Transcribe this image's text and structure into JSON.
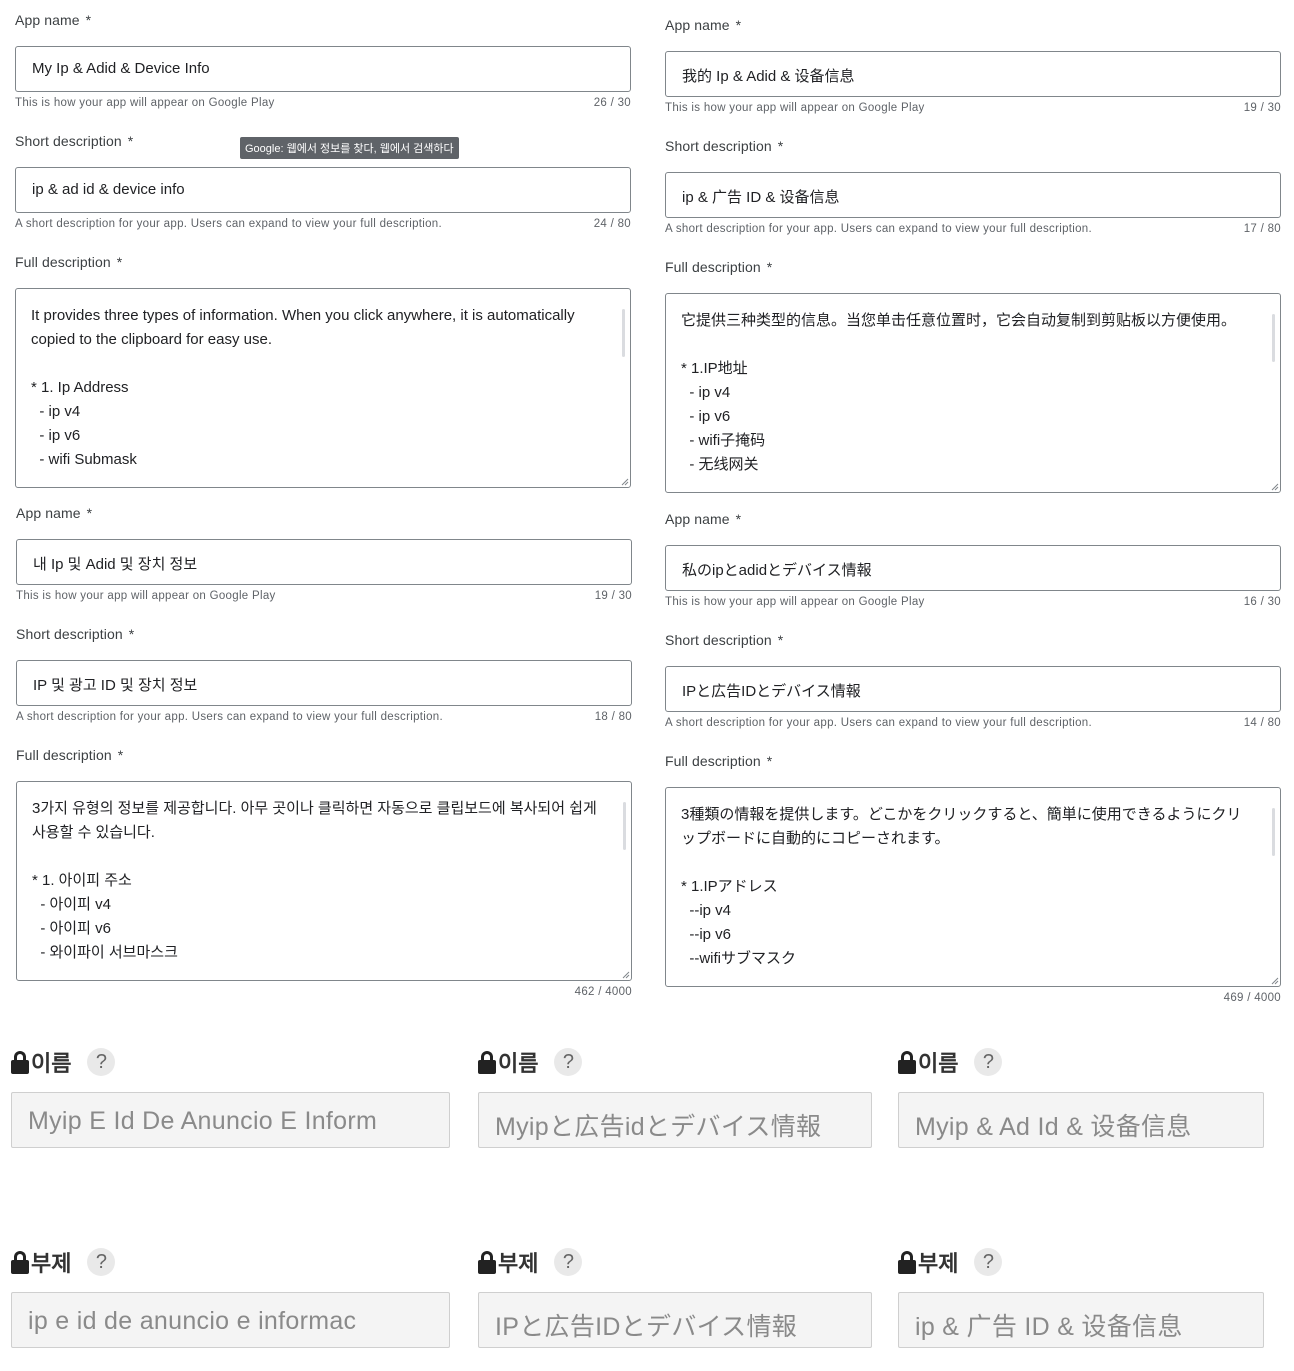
{
  "common": {
    "app_name_label": "App name",
    "short_desc_label": "Short description",
    "full_desc_label": "Full description",
    "required_mark": "*",
    "app_name_helper": "This is how your app will appear on Google Play",
    "short_desc_helper": "A short description for your app. Users can expand to view your full description."
  },
  "tooltip": "Google: 웹에서 정보를 찾다, 웹에서 검색하다",
  "listings": [
    {
      "app_name": "My Ip & Adid & Device Info",
      "app_name_count": "26 / 30",
      "short_desc": "ip & ad id & device info",
      "short_desc_count": "24 / 80",
      "full_desc": "It provides three types of information. When you click anywhere, it is automatically copied to the clipboard for easy use.\n\n* 1. Ip Address\n  - ip v4\n  - ip v6\n  - wifi Submask",
      "full_desc_count": ""
    },
    {
      "app_name": "我的 Ip & Adid & 设备信息",
      "app_name_count": "19 / 30",
      "short_desc": "ip & 广告 ID & 设备信息",
      "short_desc_count": "17 / 80",
      "full_desc": "它提供三种类型的信息。当您单击任意位置时，它会自动复制到剪贴板以方便使用。\n\n* 1.IP地址\n  - ip v4\n  - ip v6\n  - wifi子掩码\n  - 无线网关",
      "full_desc_count": ""
    },
    {
      "app_name": "내 Ip 및 Adid 및 장치 정보",
      "app_name_count": "19 / 30",
      "short_desc": "IP 및 광고 ID 및 장치 정보",
      "short_desc_count": "18 / 80",
      "full_desc": "3가지 유형의 정보를 제공합니다. 아무 곳이나 클릭하면 자동으로 클립보드에 복사되어 쉽게 사용할 수 있습니다.\n\n* 1. 아이피 주소\n  - 아이피 v4\n  - 아이피 v6\n  - 와이파이 서브마스크",
      "full_desc_count": "462 / 4000"
    },
    {
      "app_name": "私のipとadidとデバイス情報",
      "app_name_count": "16 / 30",
      "short_desc": "IPと広告IDとデバイス情報",
      "short_desc_count": "14 / 80",
      "full_desc": "3種類の情報を提供します。どこかをクリックすると、簡単に使用できるようにクリップボードに自動的にコピーされます。\n\n* 1.IPアドレス\n  --ip v4\n  --ip v6\n  --wifiサブマスク",
      "full_desc_count": "469 / 4000"
    }
  ],
  "console": {
    "name_label": "이름",
    "subtitle_label": "부제",
    "help_glyph": "?",
    "names": [
      "Myip E Id De Anuncio E Inform",
      "Myipと広告idとデバイス情報",
      "Myip & Ad Id & 设备信息"
    ],
    "subtitles": [
      "ip e id de anuncio e informac",
      "IPと広告IDとデバイス情報",
      "ip & 广告 ID & 设备信息"
    ]
  }
}
